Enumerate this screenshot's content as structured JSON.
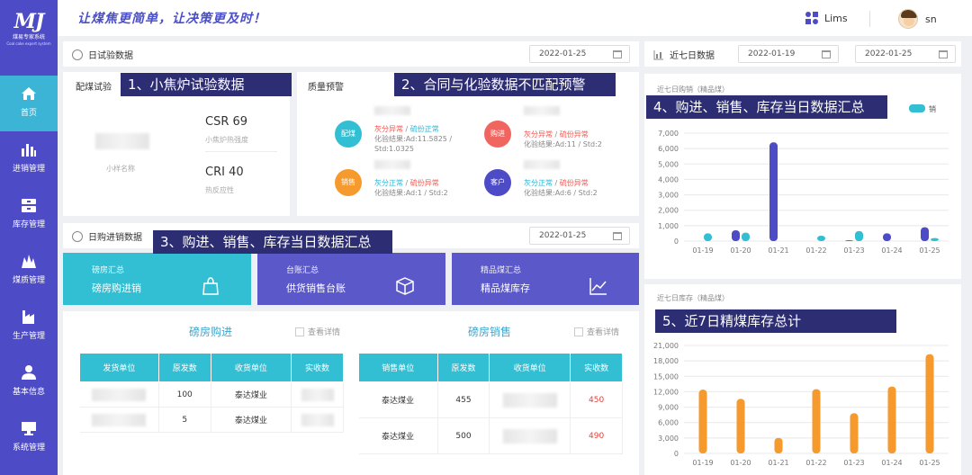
{
  "app": {
    "logo_text": "MJ",
    "logo_cn": "煤易专家系统",
    "logo_en": "Coal coke expert system",
    "slogan": "让煤焦更简单，让决策更及时！"
  },
  "header": {
    "lims_label": "Lims",
    "username": "sn"
  },
  "sidebar": {
    "items": [
      {
        "label": "首页",
        "icon": "home-icon",
        "active": true
      },
      {
        "label": "进销管理",
        "icon": "bar-chart-icon"
      },
      {
        "label": "库存管理",
        "icon": "inventory-icon"
      },
      {
        "label": "煤质管理",
        "icon": "coal-quality-icon"
      },
      {
        "label": "生产管理",
        "icon": "factory-icon"
      },
      {
        "label": "基本信息",
        "icon": "user-icon"
      },
      {
        "label": "系统管理",
        "icon": "monitor-icon"
      }
    ]
  },
  "daily_test": {
    "title": "日试验数据",
    "date": "2022-01-25",
    "sub_title": "配煤试验",
    "sample_label": "小样名称",
    "csr": "CSR 69",
    "csr_sub": "小焦炉热强度",
    "cri": "CRI 40",
    "cri_sub": "热反应性"
  },
  "quality_warning": {
    "title": "质量预警",
    "items": [
      {
        "badge": "配煤",
        "color": "#33bfd3",
        "s1": "灰分异常",
        "s2": "硫份正常",
        "result": "化验结果:Ad:11.5825 / Std:1.0325"
      },
      {
        "badge": "购进",
        "color": "#f0655f",
        "s1": "灰分异常",
        "s2": "硫份异常",
        "result": "化验结果:Ad:11 / Std:2"
      },
      {
        "badge": "销售",
        "color": "#f79a2e",
        "s1": "灰分正常",
        "s2": "硫份异常",
        "result": "化验结果:Ad:1 / Std:2"
      },
      {
        "badge": "客户",
        "color": "#4e4bc6",
        "s1": "灰分正常",
        "s2": "硫份异常",
        "result": "化验结果:Ad:6 / Std:2"
      }
    ]
  },
  "annotations": {
    "a1": "1、小焦炉试验数据",
    "a2": "2、合同与化验数据不匹配预警",
    "a3": "3、购进、销售、库存当日数据汇总",
    "a4": "4、购进、销售、库存当日数据汇总",
    "a5": "5、近7日精煤库存总计"
  },
  "daily_trade": {
    "title": "日购进销数据",
    "date": "2022-01-25",
    "cards": [
      {
        "title": "磅房汇总",
        "main": "磅房购进销",
        "color": "#33bfd3",
        "icon": "bag-icon"
      },
      {
        "title": "台账汇总",
        "main": "供货销售台账",
        "color": "#5b58c9",
        "icon": "box-icon"
      },
      {
        "title": "精品煤汇总",
        "main": "精品煤库存",
        "color": "#5b58c9",
        "icon": "line-chart-icon"
      }
    ]
  },
  "purchase_table": {
    "title": "磅房购进",
    "detail": "查看详情",
    "headers": [
      "发货单位",
      "原发数",
      "收货单位",
      "实收数"
    ],
    "rows": [
      [
        "",
        "100",
        "泰达煤业",
        ""
      ],
      [
        "",
        "5",
        "泰达煤业",
        ""
      ]
    ]
  },
  "sales_table": {
    "title": "磅房销售",
    "detail": "查看详情",
    "headers": [
      "销售单位",
      "原发数",
      "收货单位",
      "实收数"
    ],
    "rows": [
      [
        "泰达煤业",
        "455",
        "",
        "450"
      ],
      [
        "泰达煤业",
        "500",
        "",
        "490"
      ]
    ]
  },
  "seven_day": {
    "title": "近七日数据",
    "date_from": "2022-01-19",
    "date_to": "2022-01-25"
  },
  "chart_data": [
    {
      "type": "bar",
      "title": "近七日购销（精品煤）",
      "categories": [
        "01-19",
        "01-20",
        "01-21",
        "01-22",
        "01-23",
        "01-24",
        "01-25"
      ],
      "series": [
        {
          "name": "",
          "color": "#4e4bc6",
          "values": [
            0,
            700,
            6400,
            0,
            50,
            500,
            900
          ]
        },
        {
          "name": "销",
          "color": "#33bfd3",
          "values": [
            500,
            550,
            0,
            350,
            650,
            0,
            200
          ]
        }
      ],
      "ylim": [
        0,
        7000
      ],
      "yticks": [
        0,
        1000,
        2000,
        3000,
        4000,
        5000,
        6000,
        7000
      ],
      "legend": "top-right"
    },
    {
      "type": "bar",
      "title": "近七日库存（精品煤）",
      "categories": [
        "01-19",
        "01-20",
        "01-21",
        "01-22",
        "01-23",
        "01-24",
        "01-25"
      ],
      "series": [
        {
          "name": "",
          "color": "#f79a2e",
          "values": [
            12400,
            10600,
            3000,
            12500,
            7800,
            13000,
            19300
          ]
        }
      ],
      "ylim": [
        0,
        21000
      ],
      "yticks": [
        0,
        3000,
        6000,
        9000,
        12000,
        15000,
        18000,
        21000
      ]
    }
  ]
}
